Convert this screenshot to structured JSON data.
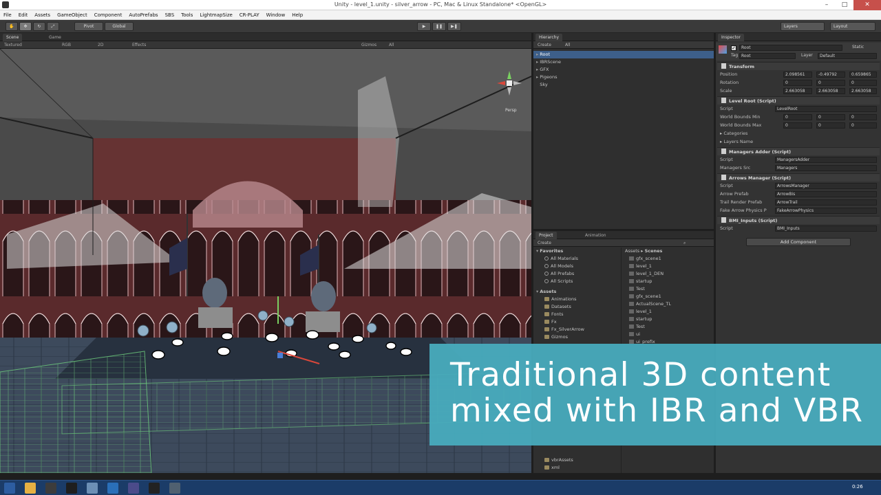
{
  "window": {
    "title": "Unity - level_1.unity - silver_arrow - PC, Mac & Linux Standalone* <OpenGL>"
  },
  "menu": [
    "File",
    "Edit",
    "Assets",
    "GameObject",
    "Component",
    "AutoPrefabs",
    "SBS",
    "Tools",
    "LightmapSize",
    "CR-PLAY",
    "Window",
    "Help"
  ],
  "toolbar": {
    "pivot": "Pivot",
    "global": "Global",
    "layers": "Layers",
    "layout": "Layout"
  },
  "scene": {
    "tabs": [
      "Scene",
      "Game"
    ],
    "shading": "Textured",
    "render_mode": "RGB",
    "mode_2d": "2D",
    "effects": "Effects",
    "gizmos": "Gizmos",
    "search": "All",
    "persp": "Persp"
  },
  "hierarchy": {
    "tab": "Hierarchy",
    "create": "Create",
    "search": "All",
    "items": [
      "Root",
      "IBRScene",
      "GFX",
      "Pigeons",
      "Sky"
    ]
  },
  "inspector": {
    "tab": "Inspector",
    "object_name": "Root",
    "static": "Static",
    "tag_label": "Tag",
    "tag_value": "Root",
    "layer_label": "Layer",
    "layer_value": "Default",
    "transform": {
      "header": "Transform",
      "position": {
        "label": "Position",
        "x": "2.098561",
        "y": "-0.49792",
        "z": "0.659865"
      },
      "rotation": {
        "label": "Rotation",
        "x": "0",
        "y": "0",
        "z": "0"
      },
      "scale": {
        "label": "Scale",
        "x": "2.663058",
        "y": "2.663058",
        "z": "2.663058"
      }
    },
    "level_root": {
      "header": "Level Root (Script)",
      "script": "LevelRoot",
      "world_min": {
        "label": "World Bounds Min",
        "x": "0",
        "y": "0",
        "z": "0"
      },
      "world_max": {
        "label": "World Bounds Max",
        "x": "0",
        "y": "0",
        "z": "0"
      },
      "categories": "Categories",
      "layers_name": "Layers Name"
    },
    "managers_adder": {
      "header": "Managers Adder (Script)",
      "script": "ManagersAdder",
      "managers_src_label": "Managers Src",
      "managers_src": "Managers"
    },
    "arrows_manager": {
      "header": "Arrows Manager (Script)",
      "script": "ArrowsManager",
      "arrow_prefab_label": "Arrow Prefab",
      "arrow_prefab": "ArrowBis",
      "trail_prefab_label": "Trail Render Prefab",
      "trail_prefab": "ArrowTrail",
      "fake_physics_label": "Fake Arrow Physics P",
      "fake_physics": "FakeArrowPhysics"
    },
    "bmi_inputs": {
      "header": "BMI_Inputs (Script)",
      "script": "BMI_Inputs"
    },
    "script_label": "Script",
    "add_component": "Add Component"
  },
  "project": {
    "tabs": [
      "Project",
      "Animation"
    ],
    "create": "Create",
    "favorites": "Favorites",
    "favorite_items": [
      "All Materials",
      "All Models",
      "All Prefabs",
      "All Scripts"
    ],
    "assets": "Assets",
    "asset_folders": [
      "Animations",
      "Datasets",
      "Fonts",
      "Fx",
      "Fx_SilverArrow",
      "Gizmos"
    ],
    "bottom_folders": [
      "vbrAssets",
      "xml"
    ],
    "breadcrumb_root": "Assets",
    "breadcrumb_current": "Scenes",
    "scene_files": [
      "gfx_scene1",
      "level_1",
      "level_1_DEN",
      "startup",
      "Test",
      "gfx_scene1",
      "ActualScene_TL",
      "level_1",
      "startup",
      "Test",
      "ui",
      "ui_prefix"
    ]
  },
  "caption": {
    "line1": "Traditional 3D content",
    "line2": "mixed with IBR and VBR"
  },
  "taskbar": {
    "time": "0:26"
  }
}
